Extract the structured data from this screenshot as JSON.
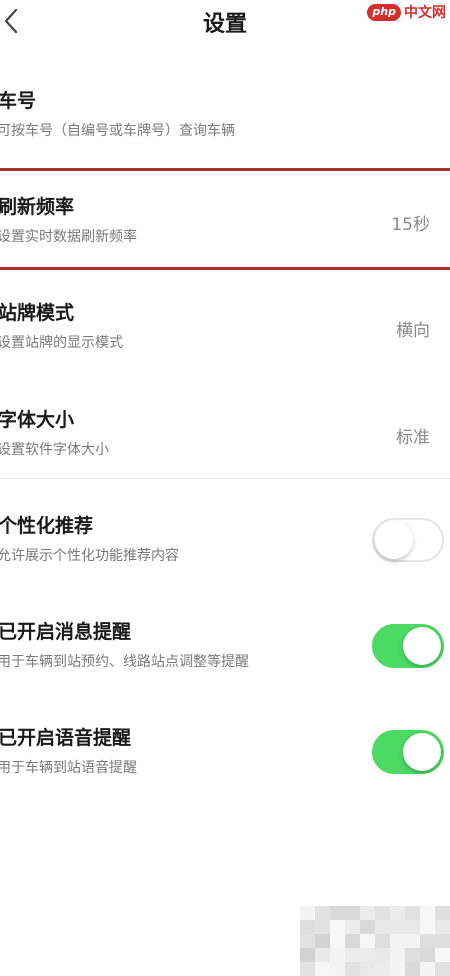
{
  "header": {
    "title": "设置",
    "back_icon": "chevron-left-icon"
  },
  "watermark": {
    "badge": "php",
    "text": "中文网",
    "color": "#d62d2d"
  },
  "settings": [
    {
      "title": "车号",
      "subtitle": "可按车号（自编号或车牌号）查询车辆",
      "value": ""
    },
    {
      "title": "刷新频率",
      "subtitle": "设置实时数据刷新频率",
      "value": "15秒",
      "highlighted": true
    },
    {
      "title": "站牌模式",
      "subtitle": "设置站牌的显示模式",
      "value": "横向"
    },
    {
      "title": "字体大小",
      "subtitle": "设置软件字体大小",
      "value": "标准"
    },
    {
      "title": "个性化推荐",
      "subtitle": "允许展示个性化功能推荐内容",
      "toggle": false
    },
    {
      "title": "已开启消息提醒",
      "subtitle": "用于车辆到站预约、线路站点调整等提醒",
      "toggle": true
    },
    {
      "title": "已开启语音提醒",
      "subtitle": "用于车辆到站语音提醒",
      "toggle": true
    }
  ],
  "colors": {
    "toggle_on": "#4cd964",
    "toggle_off_border": "#e4e4e4",
    "highlight": "#a83232"
  }
}
